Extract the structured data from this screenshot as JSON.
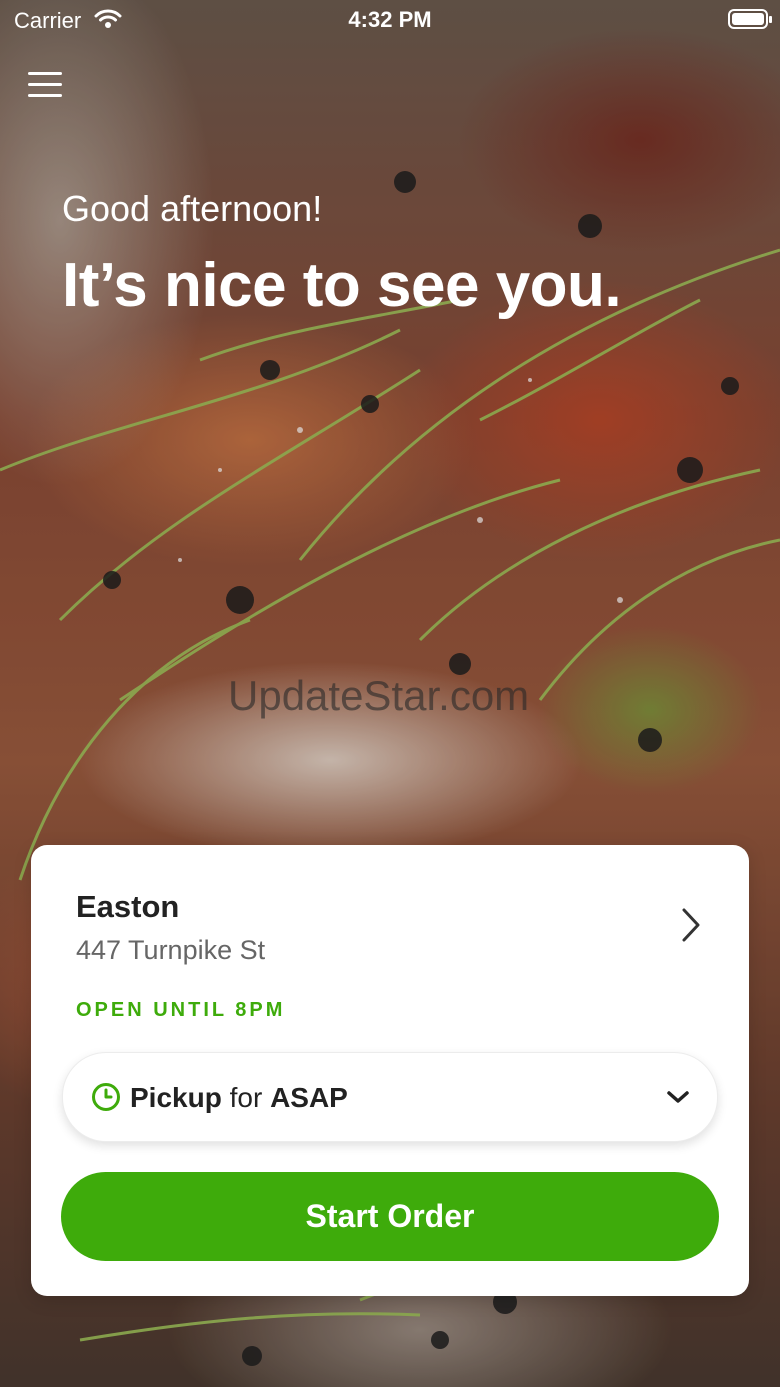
{
  "status_bar": {
    "carrier": "Carrier",
    "time": "4:32 PM",
    "wifi_icon": "wifi-icon",
    "battery_icon": "battery-icon",
    "battery_level": 1.0
  },
  "header": {
    "menu_icon": "hamburger-menu-icon"
  },
  "hero": {
    "greeting": "Good afternoon!",
    "headline": "It’s nice to see you.",
    "watermark": "UpdateStar.com"
  },
  "location_card": {
    "name": "Easton",
    "address": "447 Turnpike St",
    "status": "OPEN UNTIL 8PM",
    "chevron_icon": "chevron-right-icon",
    "order_mode": {
      "icon": "clock-icon",
      "mode": "Pickup",
      "connector": "for",
      "time": "ASAP",
      "dropdown_icon": "chevron-down-icon"
    },
    "start_button": "Start Order"
  },
  "colors": {
    "accent_green": "#3eab0b",
    "text_dark": "#222222",
    "text_secondary": "#666666",
    "card_background": "#ffffff"
  }
}
